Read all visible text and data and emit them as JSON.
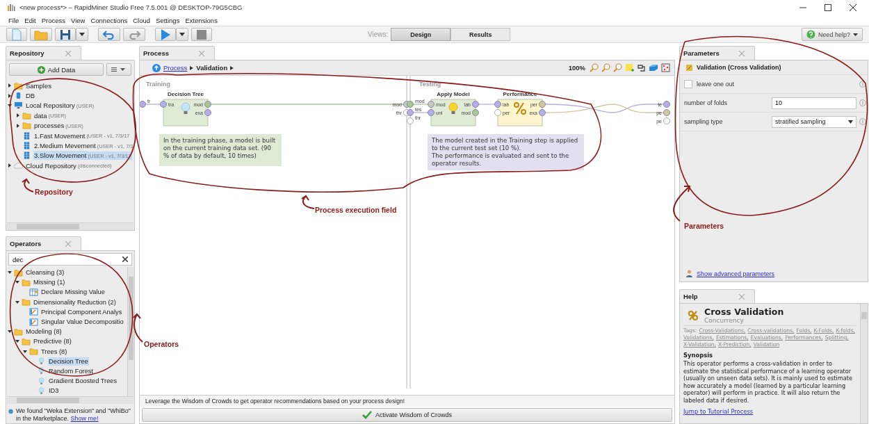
{
  "title_bar": {
    "title": "<new process*> – RapidMiner Studio Free 7.5.001 @ DESKTOP-79G5CBG"
  },
  "menu": [
    "File",
    "Edit",
    "Process",
    "View",
    "Connections",
    "Cloud",
    "Settings",
    "Extensions"
  ],
  "toolbar": {
    "views_label": "Views:",
    "views": [
      {
        "label": "Design",
        "selected": true
      },
      {
        "label": "Results",
        "selected": false
      }
    ],
    "help_button": "Need help?"
  },
  "repository": {
    "tab": "Repository",
    "add_data": "Add Data",
    "items": [
      {
        "kind": "folder",
        "label": "Samples",
        "expanded": false,
        "selected": false
      },
      {
        "kind": "db",
        "label": "DB",
        "expanded": false,
        "selected": false
      },
      {
        "kind": "computer",
        "label": "Local Repository",
        "detail": "(USER)",
        "expanded": true,
        "selected": false,
        "children": [
          {
            "kind": "folder",
            "label": "data",
            "detail": "(USER)",
            "expanded": false,
            "selected": false
          },
          {
            "kind": "folder",
            "label": "processes",
            "detail": "(USER)",
            "expanded": false,
            "selected": false
          },
          {
            "kind": "data",
            "label": "1.Fast Movement",
            "detail": "(USER - v1, 7/3/17",
            "selected": false
          },
          {
            "kind": "data",
            "label": "2.Medium Mevement",
            "detail": "(USER - v1, 7/3",
            "selected": false
          },
          {
            "kind": "data",
            "label": "3.Slow Movement",
            "detail": "(USER - v1, 7/3/17",
            "selected": true
          }
        ]
      },
      {
        "kind": "cloud",
        "label": "Cloud Repository",
        "detail": "(disconnected)",
        "expanded": false,
        "selected": false
      }
    ]
  },
  "operators": {
    "tab": "Operators",
    "search": {
      "value": "dec"
    },
    "items": [
      {
        "kind": "folder",
        "label": "Cleansing (3)",
        "expanded": true,
        "selected": false,
        "children": [
          {
            "kind": "folder",
            "label": "Missing (1)",
            "expanded": true,
            "selected": false,
            "children": [
              {
                "kind": "table",
                "label": "Declare Missing Value",
                "selected": false
              }
            ]
          },
          {
            "kind": "folder",
            "label": "Dimensionality Reduction (2)",
            "expanded": true,
            "selected": false,
            "children": [
              {
                "kind": "chart",
                "label": "Principal Component Analys",
                "selected": false
              },
              {
                "kind": "chart",
                "label": "Singular Value Decompositio",
                "selected": false
              }
            ]
          }
        ]
      },
      {
        "kind": "folder",
        "label": "Modeling (8)",
        "expanded": true,
        "selected": false,
        "children": [
          {
            "kind": "folder",
            "label": "Predictive (8)",
            "expanded": true,
            "selected": false,
            "children": [
              {
                "kind": "folder",
                "label": "Trees (8)",
                "expanded": true,
                "selected": false,
                "children": [
                  {
                    "kind": "bulb",
                    "label": "Decision Tree",
                    "selected": true
                  },
                  {
                    "kind": "bulb",
                    "label": "Random Forest",
                    "selected": false
                  },
                  {
                    "kind": "bulb",
                    "label": "Gradient Boosted Trees",
                    "selected": false
                  },
                  {
                    "kind": "bulb",
                    "label": "ID3",
                    "selected": false
                  }
                ]
              }
            ]
          }
        ]
      }
    ],
    "marketplace": {
      "message": "We found \"Weka Extension\" and \"WhiBo\" in the Marketplace.",
      "link": "Show me!"
    }
  },
  "process": {
    "tab": "Process",
    "breadcrumb": {
      "link": "Process",
      "current": "Validation"
    },
    "zoom": "100%",
    "subprocesses": [
      {
        "label": "Training",
        "input_ports": [
          {
            "label": "tr",
            "color": "#b3aee6"
          }
        ],
        "output_ports": [
          {
            "label": "mod",
            "color": "#c2cbb8"
          },
          {
            "label": "thr",
            "color": "#ffffff"
          }
        ],
        "operators": [
          {
            "name": "Decision Tree",
            "kind": "model",
            "color": "#e0ebd5",
            "in_ports": [
              {
                "label": "tra",
                "color": "#b3aee6"
              }
            ],
            "out_ports": [
              {
                "label": "mod",
                "color": "#a9c795"
              },
              {
                "label": "exa",
                "color": "#b3aee6"
              }
            ]
          }
        ],
        "note": {
          "text": "In the training phase, a model is built on the current training data set. (90 % of data by default, 10 times)",
          "color": "#dfead5"
        }
      },
      {
        "label": "Testing",
        "input_ports": [
          {
            "label": "mod",
            "color": "#a9c795"
          },
          {
            "label": "tes",
            "color": "#b3aee6"
          },
          {
            "label": "thr",
            "color": "#ffffff"
          }
        ],
        "output_ports": [
          {
            "label": "te",
            "color": "#b3aee6"
          },
          {
            "label": "pe",
            "color": "#d0c89f"
          },
          {
            "label": "pe",
            "color": "#ffffff"
          }
        ],
        "operators": [
          {
            "name": "Apply Model",
            "kind": "applier",
            "color": "#e0ebd5",
            "in_ports": [
              {
                "label": "mod",
                "color": "#c2cbb8"
              },
              {
                "label": "unl",
                "color": "#b3aee6"
              }
            ],
            "out_ports": [
              {
                "label": "lab",
                "color": "#b3aee6"
              },
              {
                "label": "mod",
                "color": "#a9c795"
              }
            ]
          },
          {
            "name": "Performance",
            "kind": "performance",
            "color": "#fcf4cc",
            "in_ports": [
              {
                "label": "lab",
                "color": "#b3aee6"
              },
              {
                "label": "per",
                "color": "#ffffff"
              }
            ],
            "out_ports": [
              {
                "label": "per",
                "color": "#d0c89f"
              },
              {
                "label": "exa",
                "color": "#b3aee6"
              }
            ]
          }
        ],
        "note": {
          "text": "The model created in the Training step is applied to the current test set (10 %).\nThe performance is evaluated and sent to the operator results.",
          "color": "#e2e0f0"
        }
      }
    ],
    "recommendation": "Leverage the Wisdom of Crowds to get operator recommendations based on your process design!",
    "activate_button": "Activate Wisdom of Crowds"
  },
  "parameters": {
    "tab": "Parameters",
    "operator": "Validation (Cross Validation)",
    "params": [
      {
        "kind": "checkbox",
        "label": "leave one out",
        "checked": false
      },
      {
        "kind": "text",
        "label": "number of folds",
        "value": "10"
      },
      {
        "kind": "select",
        "label": "sampling type",
        "value": "stratified sampling"
      }
    ],
    "advanced_link": "Show advanced parameters"
  },
  "help": {
    "tab": "Help",
    "title": "Cross Validation",
    "group": "Concurrency",
    "tags_label": "Tags:",
    "tags": [
      "Cross-Validations,",
      "Cross-validations,",
      "Folds,",
      "K-Folds,",
      "K-folds,",
      "Validations,",
      "Estimations,",
      "Evaluations,",
      "Performances,",
      "Splitting,",
      "X-Validation,",
      "X-Prediction,",
      "Validation"
    ],
    "synopsis_heading": "Synopsis",
    "synopsis": "This operator performs a cross-validation in order to estimate the statistical performance of a learning operator (usually on unseen data sets). It is mainly used to estimate how accurately a model (learned by a particular learning operator) will perform in practice. It will also return the labeled data if desired.",
    "tutorial_link": "Jump to Tutorial Process"
  },
  "annotations": [
    {
      "kind": "repository",
      "label": "Repository"
    },
    {
      "kind": "process",
      "label": "Process execution field"
    },
    {
      "kind": "parameters",
      "label": "Parameters"
    },
    {
      "kind": "operators",
      "label": "Operators"
    }
  ]
}
